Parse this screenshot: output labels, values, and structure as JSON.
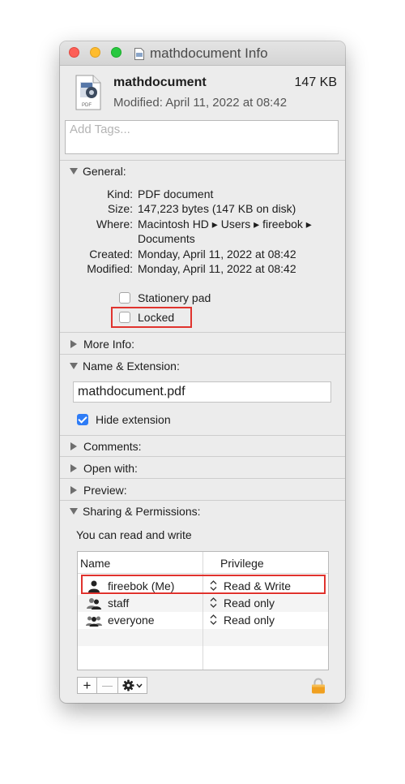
{
  "window": {
    "title": "mathdocument Info"
  },
  "header": {
    "name": "mathdocument",
    "size": "147 KB",
    "modified": "Modified: April 11, 2022 at 08:42",
    "icon_label": "PDF"
  },
  "tags": {
    "placeholder": "Add Tags..."
  },
  "general": {
    "title": "General:",
    "rows": [
      {
        "label": "Kind:",
        "value": "PDF document"
      },
      {
        "label": "Size:",
        "value": "147,223 bytes (147 KB on disk)"
      },
      {
        "label": "Where:",
        "value": "Macintosh HD ▸ Users ▸ fireebok ▸",
        "value2": "Documents"
      },
      {
        "label": "Created:",
        "value": "Monday, April 11, 2022 at 08:42"
      },
      {
        "label": "Modified:",
        "value": "Monday, April 11, 2022 at 08:42"
      }
    ],
    "stationery_label": "Stationery pad",
    "stationery_checked": false,
    "locked_label": "Locked",
    "locked_checked": false
  },
  "more_info": {
    "title": "More Info:"
  },
  "name_extension": {
    "title": "Name & Extension:",
    "filename": "mathdocument.pdf",
    "hide_extension_label": "Hide extension",
    "hide_extension_checked": true
  },
  "comments": {
    "title": "Comments:"
  },
  "open_with": {
    "title": "Open with:"
  },
  "preview": {
    "title": "Preview:"
  },
  "sharing": {
    "title": "Sharing & Permissions:",
    "status": "You can read and write",
    "columns": {
      "name": "Name",
      "privilege": "Privilege"
    },
    "rows": [
      {
        "name": "fireebok (Me)",
        "privilege": "Read & Write",
        "icon": "single-user-icon"
      },
      {
        "name": "staff",
        "privilege": "Read only",
        "icon": "group-icon"
      },
      {
        "name": "everyone",
        "privilege": "Read only",
        "icon": "everyone-icon"
      }
    ],
    "toolbar": {
      "add": "+",
      "remove": "—",
      "action_icon": "gear-icon"
    },
    "lock_icon": "lock-icon"
  },
  "colors": {
    "highlight": "#e0332e",
    "checkbox_accent": "#2e7cf6",
    "lock": "#f0a020"
  }
}
